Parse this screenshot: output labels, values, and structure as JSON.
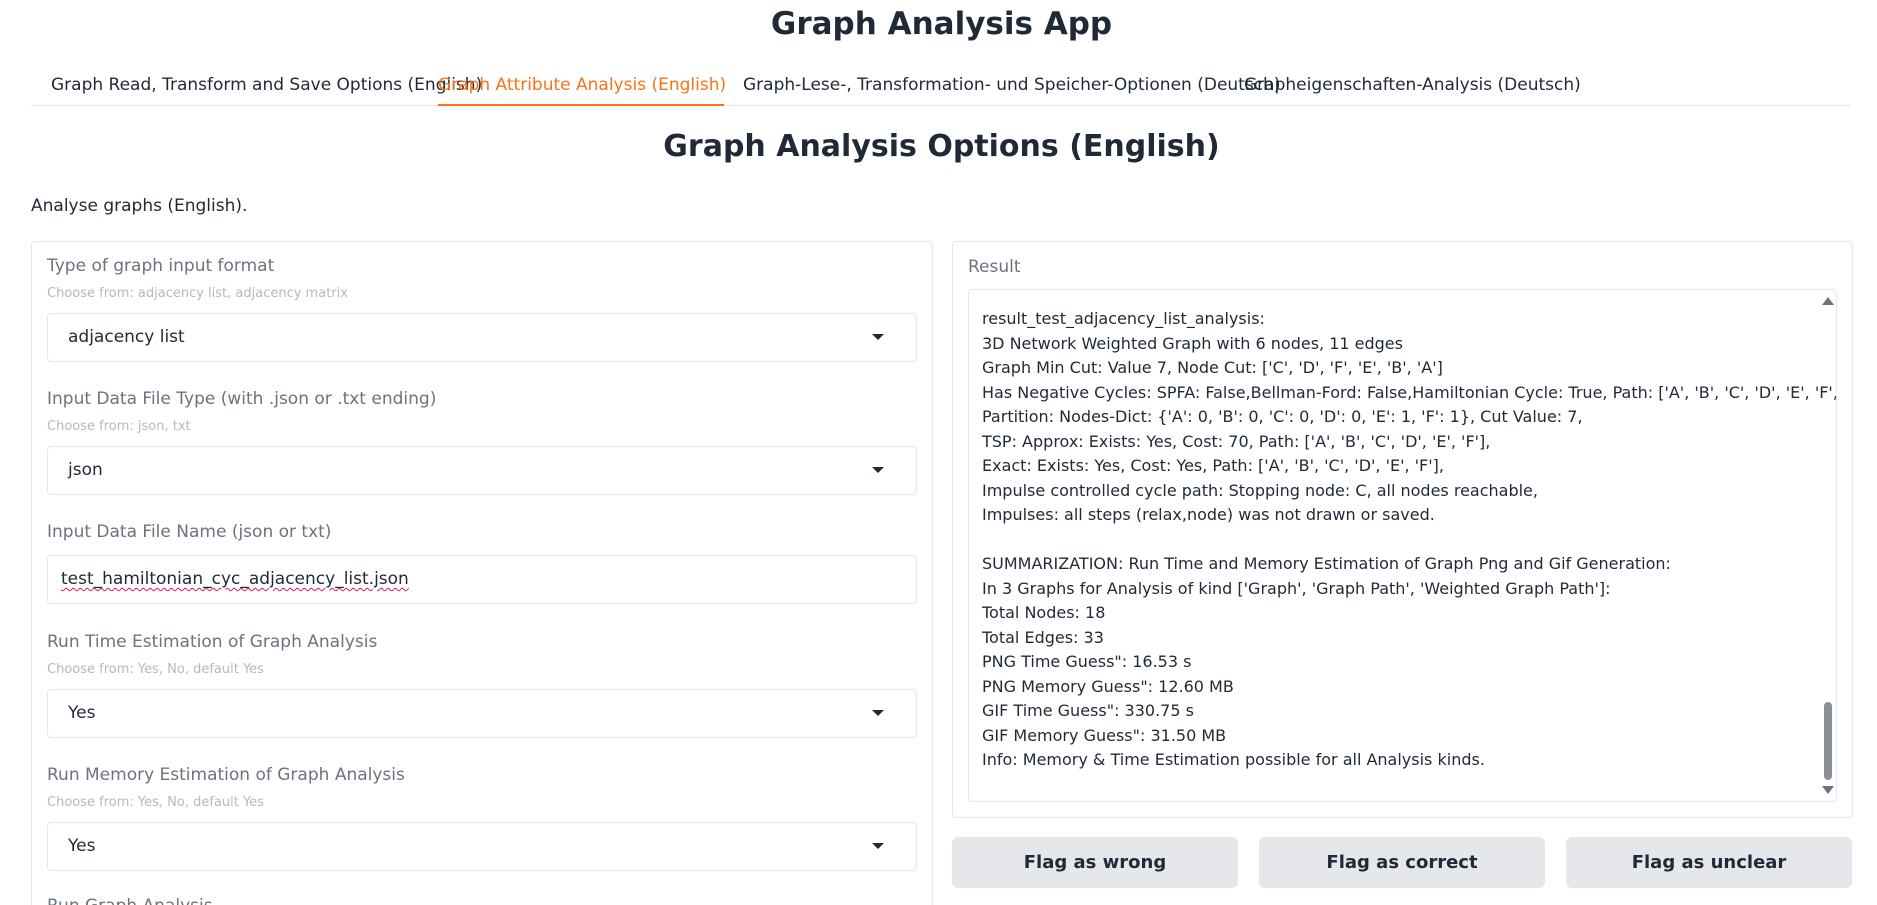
{
  "app": {
    "title": "Graph Analysis App"
  },
  "tabs": [
    {
      "label": "Graph Read, Transform and Save Options (English)",
      "active": false
    },
    {
      "label": "Graph Attribute Analysis (English)",
      "active": true
    },
    {
      "label": "Graph-Lese-, Transformation- und Speicher-Optionen (Deutsch)",
      "active": false
    },
    {
      "label": "Grapheigenschaften-Analysis (Deutsch)",
      "active": false
    }
  ],
  "section": {
    "title": "Graph Analysis Options (English)",
    "description": "Analyse graphs (English)."
  },
  "form": {
    "graph_input_format": {
      "label": "Type of graph input format",
      "info": "Choose from: adjacency list, adjacency matrix",
      "value": "adjacency list"
    },
    "file_type": {
      "label": "Input Data File Type (with .json or .txt ending)",
      "info": "Choose from: json, txt",
      "value": "json"
    },
    "file_name": {
      "label": "Input Data File Name (json or txt)",
      "value": "test_hamiltonian_cyc_adjacency_list.json"
    },
    "run_time_estimation": {
      "label": "Run Time Estimation of Graph Analysis",
      "info": "Choose from: Yes, No, default Yes",
      "value": "Yes"
    },
    "run_memory_estimation": {
      "label": "Run Memory Estimation of Graph Analysis",
      "info": "Choose from: Yes, No, default Yes",
      "value": "Yes"
    },
    "run_graph_analysis": {
      "label": "Run Graph Analysis"
    }
  },
  "result": {
    "label": "Result",
    "lines": [
      "result_test_adjacency_list_analysis:",
      "3D Network Weighted Graph with 6 nodes, 11 edges",
      "Graph Min Cut: Value 7, Node Cut: ['C', 'D', 'F', 'E', 'B', 'A']",
      "Has Negative Cycles: SPFA: False,Bellman-Ford: False,Hamiltonian Cycle: True, Path: ['A', 'B', 'C', 'D', 'E', 'F', 'A']",
      "Partition: Nodes-Dict: {'A': 0, 'B': 0, 'C': 0, 'D': 0, 'E': 1, 'F': 1}, Cut Value: 7,",
      "TSP: Approx: Exists: Yes, Cost: 70, Path: ['A', 'B', 'C', 'D', 'E', 'F'],",
      "Exact: Exists: Yes, Cost: Yes, Path: ['A', 'B', 'C', 'D', 'E', 'F'],",
      "Impulse controlled cycle path: Stopping node: C, all nodes reachable,",
      "Impulses: all steps (relax,node) was not drawn or saved.",
      "",
      "SUMMARIZATION: Run Time and Memory Estimation of Graph Png and Gif Generation:",
      "In 3 Graphs for Analysis of kind ['Graph', 'Graph Path', 'Weighted Graph Path']:",
      "Total Nodes: 18",
      "Total Edges: 33",
      "PNG Time Guess\": 16.53 s",
      "PNG Memory Guess\": 12.60 MB",
      "GIF Time Guess\": 330.75 s",
      "GIF Memory Guess\": 31.50 MB",
      "Info: Memory & Time Estimation possible for all Analysis kinds."
    ]
  },
  "flags": {
    "wrong": "Flag as wrong",
    "correct": "Flag as correct",
    "unclear": "Flag as unclear"
  },
  "colors": {
    "accent": "#f97316",
    "text": "#1f2937",
    "muted": "#6b7280",
    "border": "#e5e7eb",
    "button_bg": "#e5e7eb"
  }
}
